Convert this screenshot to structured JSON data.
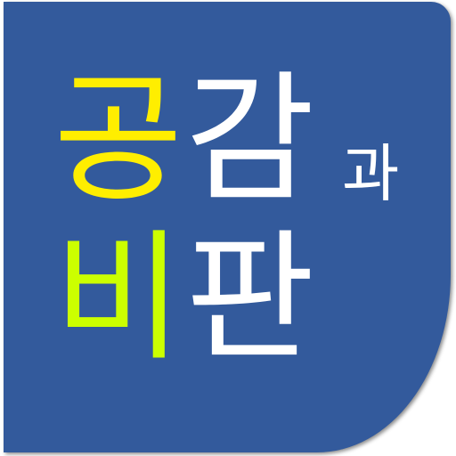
{
  "title_chars": {
    "c1": "공",
    "c2": "감",
    "c3": "과",
    "c4": "비",
    "c5": "판"
  },
  "colors": {
    "background": "#335a9c",
    "c1": "#ffee00",
    "c2": "#ffffff",
    "c3": "#ffffff",
    "c4": "#ccff00",
    "c5": "#ffffff"
  }
}
